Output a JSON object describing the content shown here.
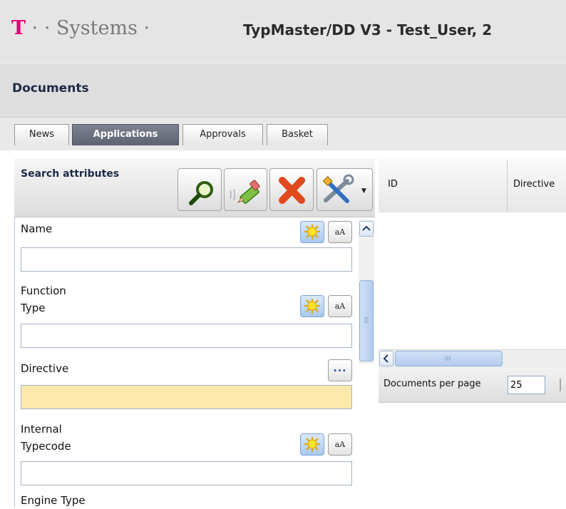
{
  "header": {
    "brand_logo_text": "T · · Systems ·",
    "app_title": "TypMaster/DD V3 - Test_User, 2"
  },
  "section_title": "Documents",
  "tabs": [
    {
      "label": "News",
      "active": false
    },
    {
      "label": "Applications",
      "active": true
    },
    {
      "label": "Approvals",
      "active": false
    },
    {
      "label": "Basket",
      "active": false
    }
  ],
  "search_panel": {
    "title": "Search attributes",
    "toolbar": {
      "search_icon": "magnifier-icon",
      "clear_icon": "eraser-pencil-icon",
      "delete_icon": "red-x-icon",
      "tools_icon": "tools-icon",
      "dropdown_icon": "dropdown-arrow-icon"
    },
    "fields": [
      {
        "label": "Name",
        "value": "",
        "wildcard_icon": "sun-icon",
        "case_label": "aA"
      },
      {
        "label_line1": "Function",
        "label_line2": "Type",
        "value": "",
        "wildcard_icon": "sun-icon",
        "case_label": "aA"
      },
      {
        "label": "Directive",
        "value": "",
        "lookup_label": "...",
        "highlight_color": "#fce9ab"
      },
      {
        "label_line1": "Internal",
        "label_line2": "Typecode",
        "value": "",
        "wildcard_icon": "sun-icon",
        "case_label": "aA"
      },
      {
        "label": "Engine Type"
      }
    ]
  },
  "grid": {
    "columns": [
      "ID",
      "Directive"
    ],
    "pager": {
      "label": "Documents per page",
      "value": "25"
    }
  },
  "colors": {
    "brand_magenta": "#e20074",
    "active_tab": "#6a6f7d",
    "highlight_input": "#fce9ab"
  }
}
